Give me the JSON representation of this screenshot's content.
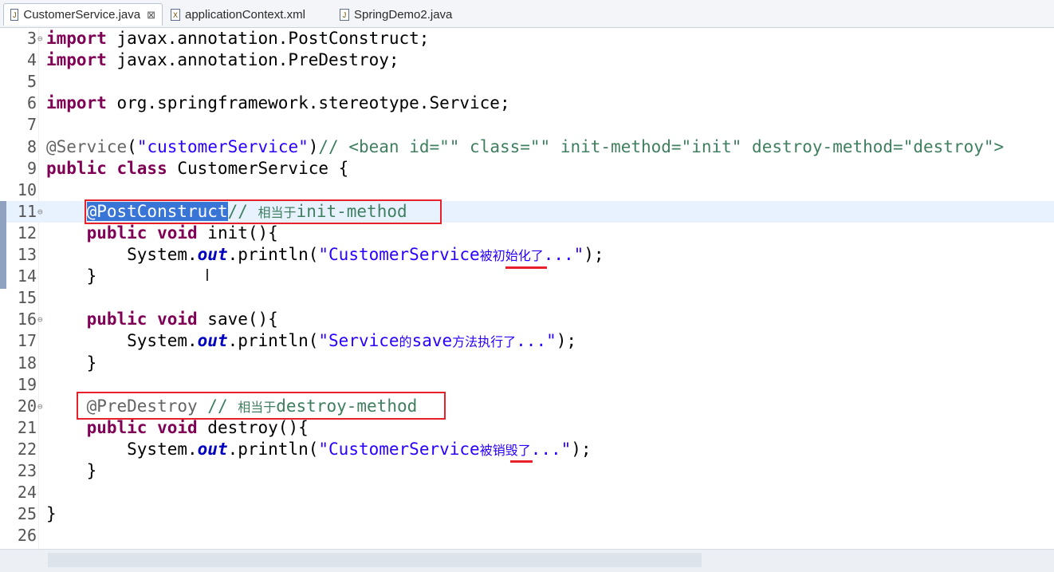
{
  "tabs": [
    {
      "label": "CustomerService.java",
      "close": "⊠",
      "icon": "J"
    },
    {
      "label": "applicationContext.xml",
      "icon": "X"
    },
    {
      "label": "SpringDemo2.java",
      "icon": "J"
    }
  ],
  "lines": [
    {
      "n": "3",
      "parts": [
        [
          "kw",
          "import"
        ],
        [
          "",
          " javax.annotation.PostConstruct;"
        ]
      ]
    },
    {
      "n": "4",
      "parts": [
        [
          "kw",
          "import"
        ],
        [
          "",
          " javax.annotation.PreDestroy;"
        ]
      ]
    },
    {
      "n": "5",
      "parts": []
    },
    {
      "n": "6",
      "parts": [
        [
          "kw",
          "import"
        ],
        [
          "",
          " org.springframework.stereotype.Service;"
        ]
      ]
    },
    {
      "n": "7",
      "parts": []
    },
    {
      "n": "8",
      "parts": [
        [
          "ann",
          "@Service"
        ],
        [
          "",
          "("
        ],
        [
          "str",
          "\"customerService\""
        ],
        [
          "",
          ")"
        ],
        [
          "cmt",
          "// <bean id=\"\" class=\"\" init-method=\"init\" destroy-method=\"destroy\">"
        ]
      ]
    },
    {
      "n": "9",
      "parts": [
        [
          "kw",
          "public class"
        ],
        [
          "",
          " CustomerService {"
        ]
      ]
    },
    {
      "n": "10",
      "parts": []
    },
    {
      "n": "11",
      "parts": [
        [
          "",
          "    "
        ],
        [
          "sel",
          "@PostConstruct"
        ],
        [
          "cmt",
          "// "
        ],
        [
          "cmt cjk",
          "相当于"
        ],
        [
          "cmt",
          "init-method"
        ]
      ]
    },
    {
      "n": "12",
      "parts": [
        [
          "",
          "    "
        ],
        [
          "kw",
          "public void"
        ],
        [
          "",
          " init(){"
        ]
      ]
    },
    {
      "n": "13",
      "parts": [
        [
          "",
          "        System."
        ],
        [
          "fld",
          "out"
        ],
        [
          "",
          ".println("
        ],
        [
          "str",
          "\"CustomerService"
        ],
        [
          "str cjk",
          "被初始化了"
        ],
        [
          "str",
          "...\""
        ],
        [
          "",
          ");"
        ]
      ]
    },
    {
      "n": "14",
      "parts": [
        [
          "",
          "    }"
        ]
      ]
    },
    {
      "n": "15",
      "parts": []
    },
    {
      "n": "16",
      "parts": [
        [
          "",
          "    "
        ],
        [
          "kw",
          "public void"
        ],
        [
          "",
          " save(){"
        ]
      ]
    },
    {
      "n": "17",
      "parts": [
        [
          "",
          "        System."
        ],
        [
          "fld",
          "out"
        ],
        [
          "",
          ".println("
        ],
        [
          "str",
          "\"Service"
        ],
        [
          "str cjk",
          "的"
        ],
        [
          "str",
          "save"
        ],
        [
          "str cjk",
          "方法执行了"
        ],
        [
          "str",
          "...\""
        ],
        [
          "",
          ");"
        ]
      ]
    },
    {
      "n": "18",
      "parts": [
        [
          "",
          "    }"
        ]
      ]
    },
    {
      "n": "19",
      "parts": []
    },
    {
      "n": "20",
      "parts": [
        [
          "",
          "    "
        ],
        [
          "ann",
          "@PreDestroy"
        ],
        [
          "cmt",
          " // "
        ],
        [
          "cmt cjk",
          "相当于"
        ],
        [
          "cmt",
          "destroy-method"
        ]
      ]
    },
    {
      "n": "21",
      "parts": [
        [
          "",
          "    "
        ],
        [
          "kw",
          "public void"
        ],
        [
          "",
          " destroy(){"
        ]
      ]
    },
    {
      "n": "22",
      "parts": [
        [
          "",
          "        System."
        ],
        [
          "fld",
          "out"
        ],
        [
          "",
          ".println("
        ],
        [
          "str",
          "\"CustomerService"
        ],
        [
          "str cjk",
          "被销毁了"
        ],
        [
          "str",
          "...\""
        ],
        [
          "",
          ");"
        ]
      ]
    },
    {
      "n": "23",
      "parts": [
        [
          "",
          "    }"
        ]
      ]
    },
    {
      "n": "24",
      "parts": []
    },
    {
      "n": "25",
      "parts": [
        [
          "",
          "}"
        ]
      ]
    },
    {
      "n": "26",
      "parts": []
    }
  ],
  "fold_lines": [
    "3",
    "11",
    "16",
    "20"
  ],
  "highlight_line": "11",
  "colors": {
    "keyword": "#7f0055",
    "string": "#2a00ff",
    "annotation": "#646464",
    "comment": "#3f7f5f",
    "field": "#0000c0",
    "selection": "#3875d7",
    "markup": "#e8202a"
  }
}
